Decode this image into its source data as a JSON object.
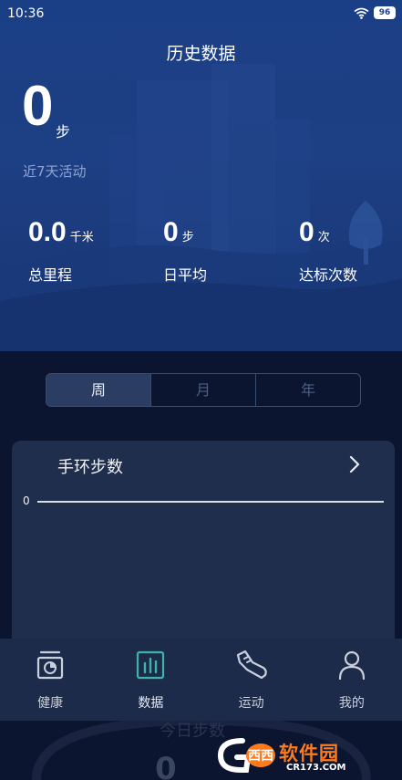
{
  "status_bar": {
    "time": "10:36",
    "battery": "96"
  },
  "header": {
    "title": "历史数据"
  },
  "summary": {
    "steps": "0",
    "steps_unit": "步",
    "subtitle": "近7天活动",
    "stats": [
      {
        "value": "0.0",
        "unit": "千米",
        "label": "总里程"
      },
      {
        "value": "0",
        "unit": "步",
        "label": "日平均"
      },
      {
        "value": "0",
        "unit": "次",
        "label": "达标次数"
      }
    ]
  },
  "period_tabs": [
    "周",
    "月",
    "年"
  ],
  "card": {
    "title": "手环步数",
    "axis_value": "0"
  },
  "background_text": {
    "caption": "今日步数",
    "value": "0"
  },
  "tabbar": [
    {
      "label": "健康",
      "icon": "scale-icon"
    },
    {
      "label": "数据",
      "icon": "bar-chart-icon"
    },
    {
      "label": "运动",
      "icon": "sneaker-icon"
    },
    {
      "label": "我的",
      "icon": "person-icon"
    }
  ],
  "watermark": {
    "brand": "软件园",
    "site": "CR173.COM"
  },
  "colors": {
    "accent": "#3fb3a6",
    "hero": "#1d3f83",
    "card": "#1f2e4d"
  }
}
